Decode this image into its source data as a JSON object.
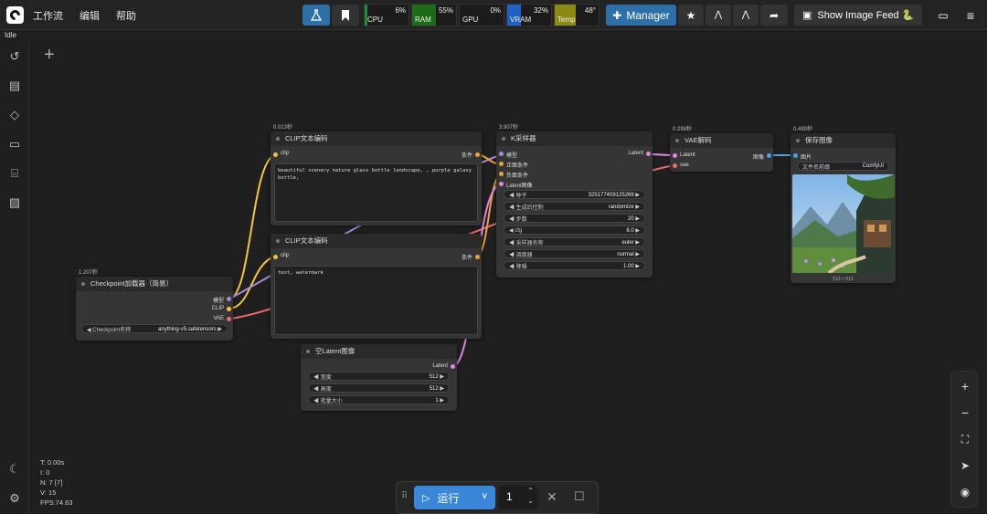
{
  "app": {
    "status": "Idle"
  },
  "menu": [
    "工作流",
    "编辑",
    "帮助"
  ],
  "monitors": [
    {
      "name": "CPU",
      "percent": "6%",
      "value": 0.06,
      "color": "#1b8c2c"
    },
    {
      "name": "RAM",
      "percent": "55%",
      "value": 0.55,
      "color": "#1e6b17"
    },
    {
      "name": "GPU",
      "percent": "0%",
      "value": 0.0,
      "color": "#1b8c2c"
    },
    {
      "name": "VRAM",
      "percent": "32%",
      "value": 0.32,
      "color": "#1d62c4"
    },
    {
      "name": "Temp",
      "percent": "48°",
      "value": 0.48,
      "color": "#8a8a12"
    }
  ],
  "toolbar": {
    "manager_label": "Manager",
    "show_feed_label": "Show Image Feed 🐍"
  },
  "nodes": {
    "clip1": {
      "timing": "0.013秒",
      "title": "CLIP文本编码",
      "in_clip": "clip",
      "out": "条件",
      "text": "beautiful scenery nature glass bottle landscape, , purple galaxy bottle,"
    },
    "clip2": {
      "title": "CLIP文本编码",
      "in_clip": "clip",
      "out": "条件",
      "text": "text, watermark"
    },
    "checkpoint": {
      "timing": "1.207秒",
      "title": "Checkpoint加载器（简易）",
      "out_model": "模型",
      "out_clip": "CLIP",
      "out_vae": "VAE",
      "widget_label": "Checkpoint名称",
      "widget_value": "anything-v5.safetensors"
    },
    "latent": {
      "title": "空Latent图像",
      "out": "Latent",
      "widgets": [
        {
          "label": "宽度",
          "value": "512"
        },
        {
          "label": "高度",
          "value": "512"
        },
        {
          "label": "批量大小",
          "value": "1"
        }
      ]
    },
    "ksampler": {
      "timing": "3.907秒",
      "title": "K采样器",
      "inputs": [
        "模型",
        "正面条件",
        "负面条件",
        "Latent图像"
      ],
      "out": "Latent",
      "widgets": [
        {
          "label": "种子",
          "value": "325177409125269"
        },
        {
          "label": "生成后控制",
          "value": "randomize"
        },
        {
          "label": "步数",
          "value": "20"
        },
        {
          "label": "cfg",
          "value": "8.0"
        },
        {
          "label": "采样器名称",
          "value": "euler"
        },
        {
          "label": "调度器",
          "value": "normal"
        },
        {
          "label": "降噪",
          "value": "1.00"
        }
      ]
    },
    "vae": {
      "timing": "0.298秒",
      "title": "VAE解码",
      "in_latent": "Latent",
      "in_vae": "vae",
      "out": "图像"
    },
    "save": {
      "timing": "0.499秒",
      "title": "保存图像",
      "in_images": "图片",
      "widget_label": "文件名前缀",
      "widget_value": "ComfyUI",
      "size_caption": "512 × 512"
    }
  },
  "run": {
    "label": "运行",
    "count": "1"
  },
  "stats": {
    "t": "T: 0.00s",
    "i": "I: 0",
    "n": "N: 7 [7]",
    "v": "V: 15",
    "fps": "FPS:74.63"
  }
}
